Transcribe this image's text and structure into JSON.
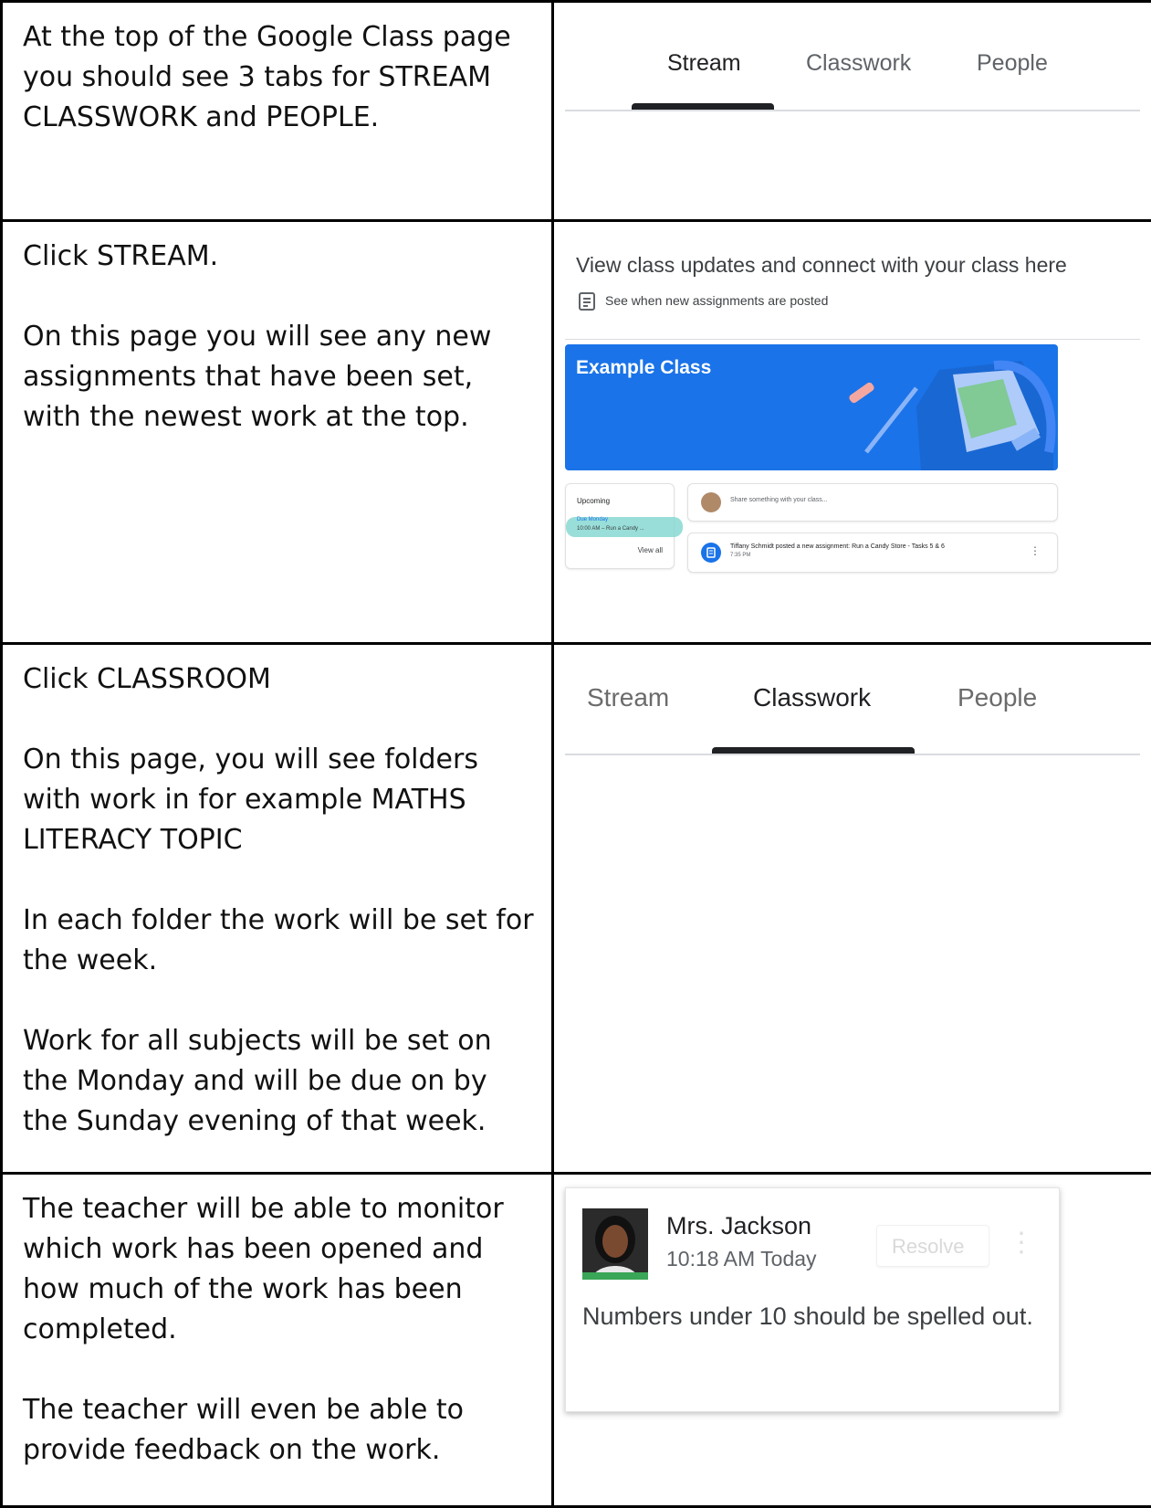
{
  "rows": [
    {
      "instructions": [
        "At the top of the Google Class page you should see 3 tabs for STREAM CLASSWORK and PEOPLE."
      ],
      "tabs": [
        "Stream",
        "Classwork",
        "People"
      ]
    },
    {
      "instructions": [
        "Click STREAM.",
        "On this page you will see any new assignments that have been set, with the newest work at the top."
      ],
      "stream": {
        "heading": "View class updates and connect with your class here",
        "sub": "See when new assignments are posted",
        "class_name": "Example Class",
        "upcoming_title": "Upcoming",
        "due_label": "Due Monday",
        "due_item": "10:00 AM – Run a Candy ...",
        "view_all": "View all",
        "share_placeholder": "Share something with your class...",
        "post_text": "Tiffany Schmidt posted a new assignment: Run a Candy Store - Tasks 5 & 6",
        "post_time": "7:35 PM",
        "colors": {
          "banner": "#1a73e8",
          "due_highlight": "#7fd6d0",
          "post_icon": "#1a73e8"
        }
      }
    },
    {
      "instructions": [
        "Click  CLASSROOM",
        "On this page, you will see folders with work in for example MATHS LITERACY   TOPIC",
        "In each folder the work will be set for the week.",
        "Work for all subjects will be set on the Monday and will be due on by the Sunday evening of that week."
      ],
      "tabs": [
        "Stream",
        "Classwork",
        "People"
      ]
    },
    {
      "instructions": [
        "The teacher will be able to monitor which work has been opened and how much of the work has been completed.",
        "The teacher will even be able to provide feedback on the work."
      ],
      "comment": {
        "author": "Mrs. Jackson",
        "time": "10:18 AM Today",
        "resolve": "Resolve",
        "body": "Numbers under 10 should be spelled out."
      }
    }
  ]
}
